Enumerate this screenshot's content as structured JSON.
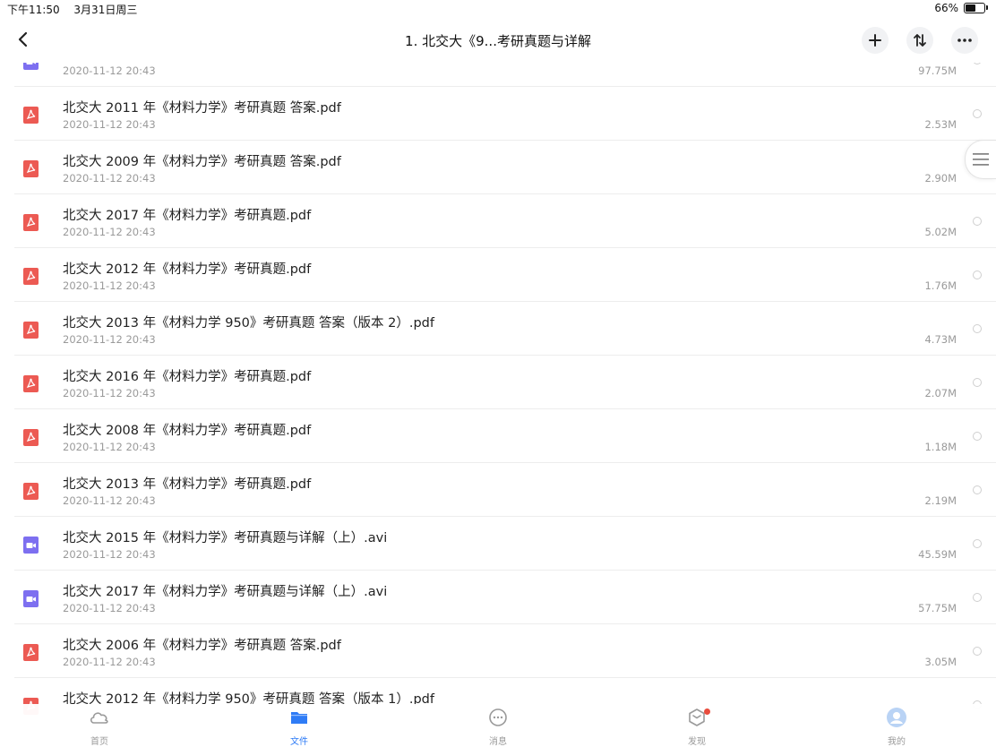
{
  "status_bar": {
    "time": "下午11:50",
    "date": "3月31日周三",
    "battery": "66%",
    "battery_level": 0.66
  },
  "nav": {
    "title": "1.  北交大《9...考研真题与详解"
  },
  "files": [
    {
      "name": "",
      "date": "2020-11-12 20:43",
      "size": "97.75M",
      "type": "video"
    },
    {
      "name": "北交大 2011 年《材料力学》考研真题 答案.pdf",
      "date": "2020-11-12 20:43",
      "size": "2.53M",
      "type": "pdf"
    },
    {
      "name": "北交大 2009 年《材料力学》考研真题 答案.pdf",
      "date": "2020-11-12 20:43",
      "size": "2.90M",
      "type": "pdf"
    },
    {
      "name": "北交大 2017 年《材料力学》考研真题.pdf",
      "date": "2020-11-12 20:43",
      "size": "5.02M",
      "type": "pdf"
    },
    {
      "name": "北交大 2012 年《材料力学》考研真题.pdf",
      "date": "2020-11-12 20:43",
      "size": "1.76M",
      "type": "pdf"
    },
    {
      "name": "北交大 2013 年《材料力学 950》考研真题 答案（版本 2）.pdf",
      "date": "2020-11-12 20:43",
      "size": "4.73M",
      "type": "pdf"
    },
    {
      "name": "北交大 2016 年《材料力学》考研真题.pdf",
      "date": "2020-11-12 20:43",
      "size": "2.07M",
      "type": "pdf"
    },
    {
      "name": "北交大 2008 年《材料力学》考研真题.pdf",
      "date": "2020-11-12 20:43",
      "size": "1.18M",
      "type": "pdf"
    },
    {
      "name": "北交大 2013 年《材料力学》考研真题.pdf",
      "date": "2020-11-12 20:43",
      "size": "2.19M",
      "type": "pdf"
    },
    {
      "name": "北交大 2015 年《材料力学》考研真题与详解（上）.avi",
      "date": "2020-11-12 20:43",
      "size": "45.59M",
      "type": "video"
    },
    {
      "name": "北交大 2017 年《材料力学》考研真题与详解（上）.avi",
      "date": "2020-11-12 20:43",
      "size": "57.75M",
      "type": "video"
    },
    {
      "name": "北交大 2006 年《材料力学》考研真题 答案.pdf",
      "date": "2020-11-12 20:43",
      "size": "3.05M",
      "type": "pdf"
    },
    {
      "name": "北交大 2012 年《材料力学 950》考研真题 答案（版本 1）.pdf",
      "date": "",
      "size": "",
      "type": "pdf"
    }
  ],
  "tabs": [
    {
      "label": "首页",
      "icon": "cloud-icon",
      "active": false
    },
    {
      "label": "文件",
      "icon": "folder-icon",
      "active": true
    },
    {
      "label": "消息",
      "icon": "chat-icon",
      "active": false
    },
    {
      "label": "发现",
      "icon": "discover-icon",
      "active": false,
      "badge": true
    },
    {
      "label": "我的",
      "icon": "avatar-icon",
      "active": false
    }
  ],
  "colors": {
    "accent": "#2f7cf6",
    "pdf_icon": "#ec5a53",
    "video_icon": "#7d6ff0",
    "badge": "#e94c3d"
  }
}
